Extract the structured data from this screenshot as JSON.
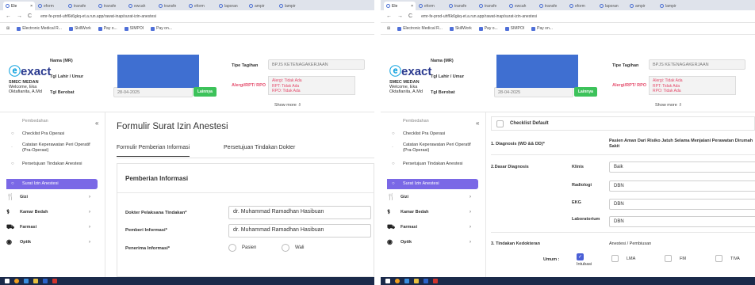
{
  "browser": {
    "tabs": [
      "Ele",
      "eform",
      "transfe",
      "transfe",
      "ewcah",
      "transfe",
      "eform",
      "laporan",
      "ampir",
      "lampir"
    ],
    "url": "emr-fe-prod-uhf6k6gkq-et.a.run.app/rawat-inap/surat-izin-anestesi",
    "bookmarks": [
      "Electronic Medical R...",
      "SkillWork",
      "Pay o...",
      "SIMPOI",
      "Pay on..."
    ]
  },
  "header": {
    "logo_text": "exact",
    "clinic_name": "SMEC MEDAN",
    "welcome": "Welcome, Eka",
    "user": "Oktafianita, A.Md",
    "fields": {
      "nama_label": "Nama (MR)",
      "tgl_lahir_label": "Tgl Lahir / Umur",
      "tgl_berobat_label": "Tgl Berobat",
      "tgl_berobat_value": "28-04-2025",
      "tipe_tagihan_label": "Tipe Tagihan",
      "tipe_tagihan_value": "BPJS KETENAGAKERJAAN",
      "alergi_label": "Alergi/RPT/ RPO",
      "alergi_lines": [
        "Alergi: Tidak Ada",
        "RPT: Tidak Ada",
        "RPO: Tidak Ada"
      ],
      "lainnya_btn": "Lainnya",
      "show_more": "Show more ⇩"
    }
  },
  "sidebar": {
    "items": [
      {
        "label": "Pembedahan",
        "type": "faded"
      },
      {
        "label": "Checklist Pra Operasi",
        "type": "sub"
      },
      {
        "label": "Catatan Keperawatan Peri Operatif (Pra-Operasi)",
        "type": "sub"
      },
      {
        "label": "Persetujuan Tindakan Anestesi",
        "type": "sub"
      },
      {
        "label": "Surat Izin Anestesi",
        "type": "active"
      },
      {
        "label": "Gizi",
        "type": "main",
        "icon": "restaurant-icon"
      },
      {
        "label": "Kamar Bedah",
        "type": "main",
        "icon": "surgery-icon"
      },
      {
        "label": "Farmasi",
        "type": "main",
        "icon": "pharmacy-icon"
      },
      {
        "label": "Optik",
        "type": "main",
        "icon": "eye-icon"
      }
    ]
  },
  "left_form": {
    "title": "Formulir Surat Izin Anestesi",
    "tabs": [
      "Formulir Pemberian Informasi",
      "Persetujuan Tindakan Dokter"
    ],
    "card_title": "Pemberian Informasi",
    "rows": [
      {
        "label": "Dokter Pelaksana Tindakan*",
        "value": "dr. Muhammad Ramadhan Hasibuan"
      },
      {
        "label": "Pemberi Informasi*",
        "value": "dr. Muhammad Ramadhan Hasibuan"
      }
    ],
    "penerima_label": "Penerima Informasi*",
    "penerima_options": [
      "Pasien",
      "Wali"
    ]
  },
  "right_form": {
    "checklist_default": "Checklist Default",
    "diagnosis_label": "1. Diagnosis (WD && DD)*",
    "diagnosis_value": "Pasien Aman Dari Risiko Jatuh Selama Menjalani Perawatan Dirumah Sakit",
    "dasar_label": "2.Dasar Diagnosis",
    "dasar_rows": [
      {
        "label": "Klinis",
        "value": "Baik"
      },
      {
        "label": "Radiologi",
        "value": "DBN"
      },
      {
        "label": "EKG",
        "value": "DBN"
      },
      {
        "label": "Laboratorium",
        "value": "DBN"
      }
    ],
    "tindakan_label": "3. Tindakan Kedokteran",
    "anestesi_label": "Anestesi / Pembiusan",
    "umum_label": "Umum :",
    "umum_options": [
      "Intubasi",
      "LMA",
      "FM",
      "TIVA"
    ]
  },
  "colors": {
    "active_nav": "#7a68e6",
    "redaction": "#3f6fd1",
    "alert": "#e44a6a",
    "green_button": "#3cc25a"
  }
}
